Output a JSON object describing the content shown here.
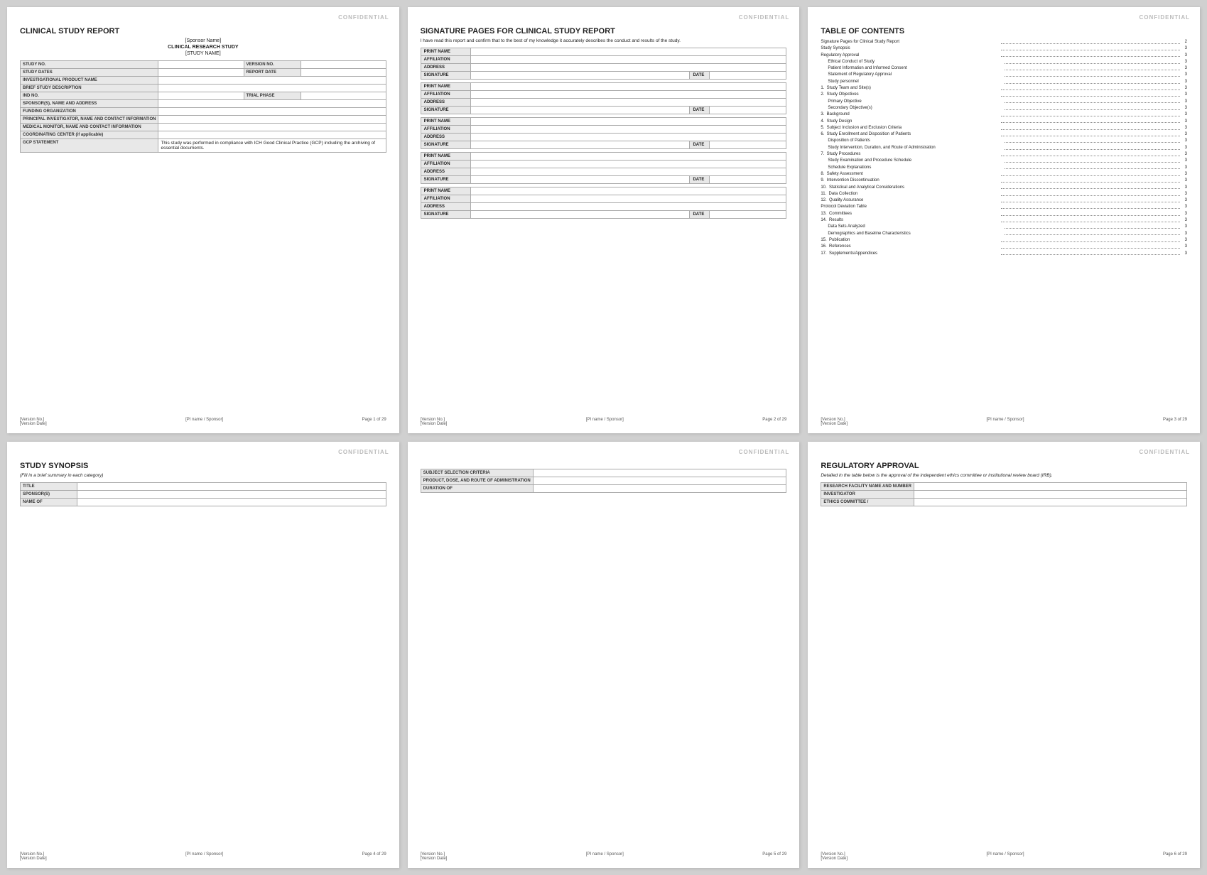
{
  "pages": [
    {
      "id": "page1",
      "confidential": "CONFIDENTIAL",
      "title": "CLINICAL STUDY REPORT",
      "subtitles": [
        "[Sponsor Name]",
        "CLINICAL RESEARCH STUDY",
        "[STUDY NAME]"
      ],
      "footer": {
        "left": "[Version No.]\n[Version Date]",
        "center": "[PI name / Sponsor]",
        "right": "Page 1 of 29"
      },
      "fields": [
        {
          "label": "STUDY NO.",
          "value": "",
          "colspan_label": 1,
          "colspan_value": 1,
          "extra_label": "VERSION NO.",
          "extra_value": ""
        },
        {
          "label": "STUDY DATES",
          "value": "",
          "colspan_label": 1,
          "colspan_value": 1,
          "extra_label": "REPORT DATE",
          "extra_value": ""
        },
        {
          "label": "INVESTIGATIONAL PRODUCT NAME",
          "value": "",
          "tall": true,
          "full": true
        },
        {
          "label": "BRIEF STUDY DESCRIPTION",
          "value": "",
          "taller": true,
          "full": true
        },
        {
          "label": "IND NO.",
          "value": "",
          "colspan_label": 1,
          "colspan_value": 1,
          "extra_label": "TRIAL PHASE",
          "extra_value": ""
        },
        {
          "label": "SPONSOR(S), NAME AND ADDRESS",
          "value": "",
          "taller": true,
          "full": true
        },
        {
          "label": "FUNDING ORGANIZATION",
          "value": "",
          "tall": true,
          "full": true
        },
        {
          "label": "PRINCIPAL INVESTIGATOR, NAME AND CONTACT INFORMATION",
          "value": "",
          "taller": true,
          "full": true
        },
        {
          "label": "MEDICAL MONITOR, NAME AND CONTACT INFORMATION",
          "value": "",
          "taller": true,
          "full": true
        },
        {
          "label": "COORDINATING CENTER (if applicable)",
          "value": "",
          "tall": true,
          "full": true
        },
        {
          "label": "GCP STATEMENT",
          "value": "This study was performed in compliance with ICH Good Clinical Practice (GCP) including the archiving of essential documents.",
          "full": true,
          "tall": true
        }
      ]
    },
    {
      "id": "page2",
      "confidential": "CONFIDENTIAL",
      "title": "SIGNATURE PAGES FOR CLINICAL STUDY REPORT",
      "intro": "I have read this report and confirm that to the best of my knowledge it accurately describes the conduct and results of the study.",
      "footer": {
        "left": "[Version No.]\n[Version Date]",
        "center": "[PI name / Sponsor]",
        "right": "Page 2 of 29"
      },
      "signature_blocks": [
        {
          "rows": [
            {
              "label": "PRINT NAME",
              "value": "",
              "date": false
            },
            {
              "label": "AFFILIATION",
              "value": "",
              "date": false
            },
            {
              "label": "ADDRESS",
              "value": "",
              "date": false
            },
            {
              "label": "SIGNATURE",
              "value": "",
              "date": true
            }
          ]
        },
        {
          "rows": [
            {
              "label": "PRINT NAME",
              "value": "",
              "date": false
            },
            {
              "label": "AFFILIATION",
              "value": "",
              "date": false
            },
            {
              "label": "ADDRESS",
              "value": "",
              "date": false
            },
            {
              "label": "SIGNATURE",
              "value": "",
              "date": true
            }
          ]
        },
        {
          "rows": [
            {
              "label": "PRINT NAME",
              "value": "",
              "date": false
            },
            {
              "label": "AFFILIATION",
              "value": "",
              "date": false
            },
            {
              "label": "ADDRESS",
              "value": "",
              "date": false
            },
            {
              "label": "SIGNATURE",
              "value": "",
              "date": true
            }
          ]
        },
        {
          "rows": [
            {
              "label": "PRINT NAME",
              "value": "",
              "date": false
            },
            {
              "label": "AFFILIATION",
              "value": "",
              "date": false
            },
            {
              "label": "ADDRESS",
              "value": "",
              "date": false
            },
            {
              "label": "SIGNATURE",
              "value": "",
              "date": true
            }
          ]
        },
        {
          "rows": [
            {
              "label": "PRINT NAME",
              "value": "",
              "date": false
            },
            {
              "label": "AFFILIATION",
              "value": "",
              "date": false
            },
            {
              "label": "ADDRESS",
              "value": "",
              "date": false
            },
            {
              "label": "SIGNATURE",
              "value": "",
              "date": true
            }
          ]
        }
      ]
    },
    {
      "id": "page3",
      "confidential": "CONFIDENTIAL",
      "title": "TABLE OF CONTENTS",
      "footer": {
        "left": "[Version No.]\n[Version Date]",
        "center": "[PI name / Sponsor]",
        "right": "Page 3 of 29"
      },
      "toc": [
        {
          "text": "Signature Pages for Clinical Study Report",
          "num": "2",
          "indent": 0
        },
        {
          "text": "Study Synopsis",
          "num": "3",
          "indent": 0
        },
        {
          "text": "Regulatory Approval",
          "num": "3",
          "indent": 0
        },
        {
          "text": "Ethical Conduct of Study",
          "num": "3",
          "indent": 1
        },
        {
          "text": "Patient Information and Informed Consent",
          "num": "3",
          "indent": 1
        },
        {
          "text": "Statement of Regulatory Approval",
          "num": "3",
          "indent": 1
        },
        {
          "text": "Study personnel",
          "num": "3",
          "indent": 1
        },
        {
          "text": "Study Team and Site(s)",
          "num": "3",
          "indent": 0,
          "num_prefix": "1."
        },
        {
          "text": "Study Objectives",
          "num": "3",
          "indent": 0,
          "num_prefix": "2."
        },
        {
          "text": "Primary Objective",
          "num": "3",
          "indent": 1
        },
        {
          "text": "Secondary Objective(s)",
          "num": "3",
          "indent": 1
        },
        {
          "text": "Background",
          "num": "3",
          "indent": 0,
          "num_prefix": "3."
        },
        {
          "text": "Study Design",
          "num": "3",
          "indent": 0,
          "num_prefix": "4."
        },
        {
          "text": "Subject Inclusion and Exclusion Criteria",
          "num": "3",
          "indent": 0,
          "num_prefix": "5."
        },
        {
          "text": "Study Enrollment and Disposition of Patients",
          "num": "3",
          "indent": 0,
          "num_prefix": "6."
        },
        {
          "text": "Disposition of Patients",
          "num": "3",
          "indent": 1
        },
        {
          "text": "Study Intervention, Duration, and Route of Administration",
          "num": "3",
          "indent": 1
        },
        {
          "text": "Study Procedures",
          "num": "3",
          "indent": 0,
          "num_prefix": "7."
        },
        {
          "text": "Study Examination and Procedure Schedule",
          "num": "3",
          "indent": 1
        },
        {
          "text": "Schedule Explanations",
          "num": "3",
          "indent": 1
        },
        {
          "text": "Safety Assessment",
          "num": "3",
          "indent": 0,
          "num_prefix": "8."
        },
        {
          "text": "Intervention Discontinuation",
          "num": "3",
          "indent": 0,
          "num_prefix": "9."
        },
        {
          "text": "Statistical and Analytical Considerations",
          "num": "3",
          "indent": 0,
          "num_prefix": "10."
        },
        {
          "text": "Data Collection",
          "num": "3",
          "indent": 0,
          "num_prefix": "11."
        },
        {
          "text": "Quality Assurance",
          "num": "3",
          "indent": 0,
          "num_prefix": "12."
        },
        {
          "text": "Protocol Deviation Table",
          "num": "3",
          "indent": 0
        },
        {
          "text": "Committees",
          "num": "3",
          "indent": 0,
          "num_prefix": "13."
        },
        {
          "text": "Results",
          "num": "3",
          "indent": 0,
          "num_prefix": "14."
        },
        {
          "text": "Data Sets Analyzed",
          "num": "3",
          "indent": 1
        },
        {
          "text": "Demographics and Baseline Characteristics",
          "num": "3",
          "indent": 1
        },
        {
          "text": "Publication",
          "num": "3",
          "indent": 0,
          "num_prefix": "15."
        },
        {
          "text": "References",
          "num": "3",
          "indent": 0,
          "num_prefix": "16."
        },
        {
          "text": "Supplements/Appendices",
          "num": "3",
          "indent": 0,
          "num_prefix": "17."
        }
      ]
    },
    {
      "id": "page4",
      "confidential": "CONFIDENTIAL",
      "title": "STUDY SYNOPSIS",
      "note": "(Fill in a brief summary in each category)",
      "footer": {
        "left": "[Version No.]\n[Version Date]",
        "center": "[PI name / Sponsor]",
        "right": "Page 4 of 29"
      },
      "fields": [
        {
          "label": "TITLE",
          "value": "",
          "full": true,
          "tall": true
        },
        {
          "label": "SPONSOR(S)",
          "value": "",
          "full": true,
          "tall": true
        },
        {
          "label": "NAME OF",
          "value": "",
          "full": true,
          "tall": true
        }
      ]
    },
    {
      "id": "page5",
      "confidential": "CONFIDENTIAL",
      "title": "",
      "footer": {
        "left": "[Version No.]\n[Version Date]",
        "center": "[PI name / Sponsor]",
        "right": "Page 5 of 29"
      },
      "fields": [
        {
          "label": "SUBJECT SELECTION CRITERIA",
          "value": "",
          "full": true,
          "taller": true
        },
        {
          "label": "PRODUCT, DOSE, AND ROUTE OF ADMINISTRATION",
          "value": "",
          "full": true,
          "taller": true
        },
        {
          "label": "DURATION OF",
          "value": "",
          "full": true,
          "taller": true
        }
      ]
    },
    {
      "id": "page6",
      "confidential": "CONFIDENTIAL",
      "title": "REGULATORY APPROVAL",
      "intro": "Detailed in the table below is the approval of the independent ethics committee or institutional review board (IRB).",
      "footer": {
        "left": "[Version No.]\n[Version Date]",
        "center": "[PI name / Sponsor]",
        "right": "Page 6 of 29"
      },
      "fields": [
        {
          "label": "RESEARCH FACILITY NAME AND NUMBER",
          "value": "",
          "full": true,
          "tall": true
        },
        {
          "label": "INVESTIGATOR",
          "value": "",
          "full": true,
          "tall": true
        },
        {
          "label": "ETHICS COMMITTEE /",
          "value": "",
          "full": true,
          "tall": true
        }
      ]
    }
  ]
}
